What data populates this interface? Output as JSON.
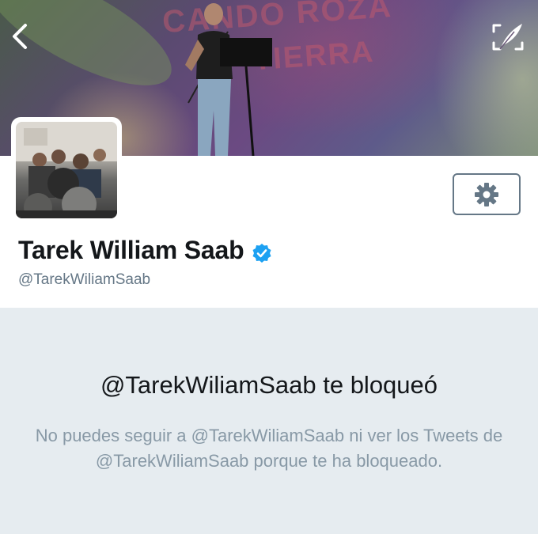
{
  "header": {
    "banner_text_line1": "CANDO ROZA",
    "banner_text_line2": "TIERRA",
    "back_icon": "chevron-left-icon",
    "edit_icon": "compose-icon"
  },
  "profile": {
    "display_name": "Tarek William Saab",
    "handle": "@TarekWiliamSaab",
    "verified": true,
    "settings_icon": "gear-icon"
  },
  "blocked": {
    "title": "@TarekWiliamSaab te bloqueó",
    "message": "No puedes seguir a @TarekWiliamSaab ni ver los Tweets de @TarekWiliamSaab porque te ha bloqueado."
  },
  "colors": {
    "verified_blue": "#1da1f2",
    "secondary_text": "#657786",
    "muted_text": "#8899a6",
    "background_gray": "#e6ecf0"
  }
}
